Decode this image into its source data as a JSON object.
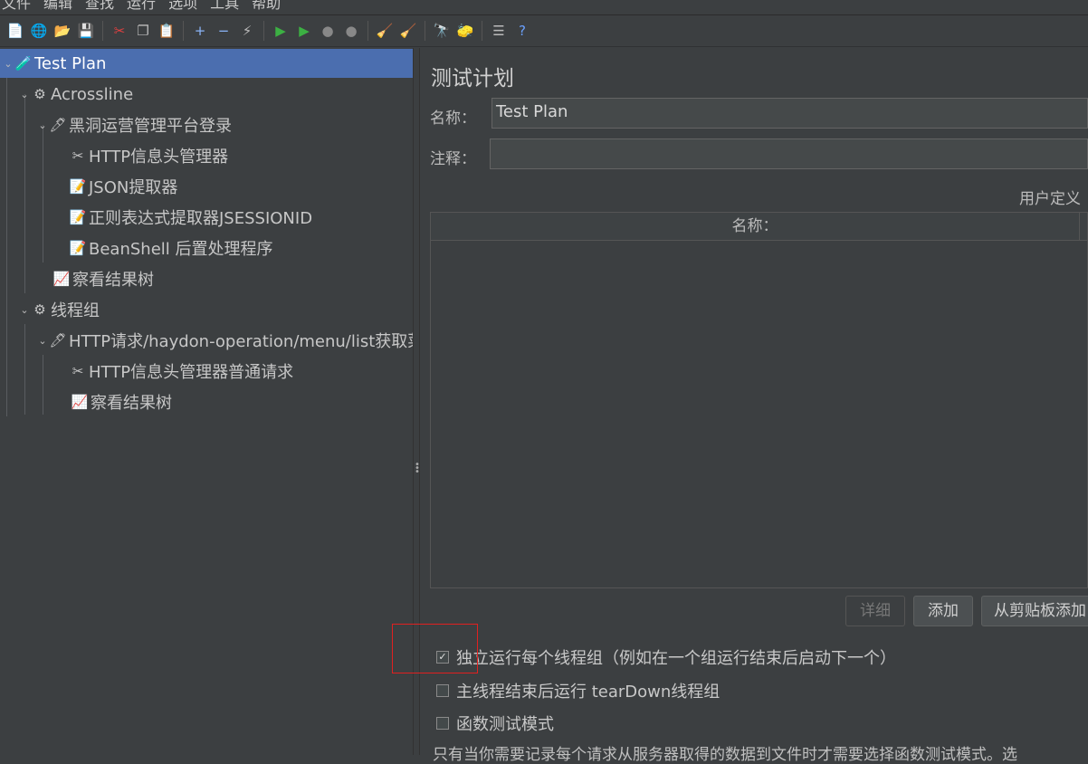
{
  "menubar": [
    "文件",
    "编辑",
    "查找",
    "运行",
    "选项",
    "工具",
    "帮助"
  ],
  "toolbar": [
    {
      "name": "new-icon",
      "glyph": "📄"
    },
    {
      "name": "templates-icon",
      "glyph": "🌐"
    },
    {
      "name": "open-icon",
      "glyph": "📂"
    },
    {
      "name": "save-icon",
      "glyph": "💾"
    },
    {
      "sep": true
    },
    {
      "name": "cut-icon",
      "glyph": "✂"
    },
    {
      "name": "copy-icon",
      "glyph": "❐"
    },
    {
      "name": "paste-icon",
      "glyph": "📋"
    },
    {
      "sep": true
    },
    {
      "name": "expand-icon",
      "glyph": "+"
    },
    {
      "name": "collapse-icon",
      "glyph": "−"
    },
    {
      "name": "toggle-icon",
      "glyph": "⚡"
    },
    {
      "sep": true
    },
    {
      "name": "start-icon",
      "glyph": "▶"
    },
    {
      "name": "start-no-pause-icon",
      "glyph": "▶"
    },
    {
      "name": "stop-icon",
      "glyph": "●"
    },
    {
      "name": "shutdown-icon",
      "glyph": "●"
    },
    {
      "sep": true
    },
    {
      "name": "clear-icon",
      "glyph": "🧹"
    },
    {
      "name": "clear-all-icon",
      "glyph": "🧹"
    },
    {
      "sep": true
    },
    {
      "name": "search-icon",
      "glyph": "🔭"
    },
    {
      "name": "reset-search-icon",
      "glyph": "🧽"
    },
    {
      "sep": true
    },
    {
      "name": "function-helper-icon",
      "glyph": "☰"
    },
    {
      "name": "help-icon",
      "glyph": "?"
    }
  ],
  "tree": [
    {
      "label": "Test Plan",
      "icon": "🧪",
      "chev": true
    },
    {
      "label": "Acrossline",
      "icon": "⚙",
      "chev": true
    },
    {
      "label": "黑洞运营管理平台登录",
      "icon": "🖊",
      "chev": true
    },
    {
      "label": "HTTP信息头管理器",
      "icon": "✂",
      "chev": false
    },
    {
      "label": "JSON提取器",
      "icon": "📝",
      "chev": false
    },
    {
      "label": "正则表达式提取器JSESSIONID",
      "icon": "📝",
      "chev": false
    },
    {
      "label": "BeanShell 后置处理程序",
      "icon": "📝",
      "chev": false
    },
    {
      "label": "察看结果树",
      "icon": "📈",
      "chev": false
    },
    {
      "label": "线程组",
      "icon": "⚙",
      "chev": true
    },
    {
      "label": "HTTP请求/haydon-operation/menu/list获取菜",
      "icon": "🖊",
      "chev": true
    },
    {
      "label": "HTTP信息头管理器普通请求",
      "icon": "✂",
      "chev": false
    },
    {
      "label": "察看结果树",
      "icon": "📈",
      "chev": false
    }
  ],
  "panel": {
    "title": "测试计划",
    "name_label": "名称：",
    "name_value": "Test Plan",
    "comment_label": "注释：",
    "comment_value": "",
    "user_vars_label": "用户定义",
    "table_header": "名称：",
    "btn_detail": "详细",
    "btn_add": "添加",
    "btn_add_clipboard": "从剪贴板添加",
    "check_independent": "独立运行每个线程组（例如在一个组运行结束后启动下一个）",
    "check_teardown": "主线程结束后运行 tearDown线程组",
    "check_functional": "函数测试模式",
    "note": "只有当你需要记录每个请求从服务器取得的数据到文件时才需要选择函数测试模式。选"
  },
  "checks": {
    "independent": true,
    "teardown": false,
    "functional": false
  }
}
